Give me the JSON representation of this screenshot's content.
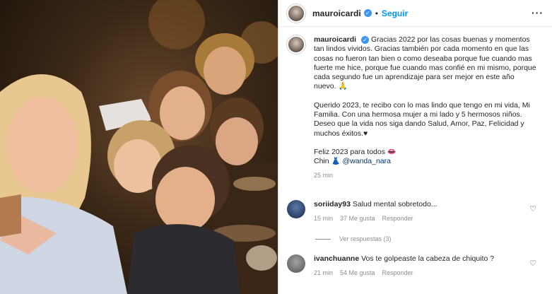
{
  "header": {
    "username": "mauroicardi",
    "separator": "•",
    "follow_label": "Seguir",
    "more_icon": "more-options-icon",
    "more_glyph": "···"
  },
  "caption": {
    "username": "mauroicardi",
    "text_1": "Gracias 2022 por las cosas buenas y momentos tan lindos vividos. Gracias también por cada momento en que las cosas no fueron tan bien o como deseaba porque fue cuando mas fuerte me hice, porque fue cuando mas confié en mi mismo, porque cada segundo fue un aprendizaje para ser mejor en este año nuevo. 🙏",
    "text_2": "Querido 2023, te recibo con lo mas lindo que tengo en mi vida, Mi Familia. Con una hermosa mujer a mi lado y 5 hermosos niños. Deseo que la vida nos siga dando Salud, Amor, Paz, Felicidad y muchos éxitos.♥",
    "text_3": "Feliz 2023 para todos 👄",
    "text_4_prefix": "Chin 👗",
    "mention": "@wanda_nara",
    "time": "25 min"
  },
  "comments": [
    {
      "username": "soriiday93",
      "text": "Salud mental sobretodo...",
      "time": "15 min",
      "likes": "37 Me gusta",
      "reply": "Responder"
    },
    {
      "username": "ivanchuanne",
      "text": "Vos te golpeaste la cabeza de chiquito ?",
      "time": "21 min",
      "likes": "54 Me gusta",
      "reply": "Responder"
    }
  ],
  "view_replies": "Ver respuestas (3)",
  "colors": {
    "accent": "#0095f6",
    "verified": "#3897f0",
    "muted": "#8e8e8e",
    "text": "#262626"
  }
}
